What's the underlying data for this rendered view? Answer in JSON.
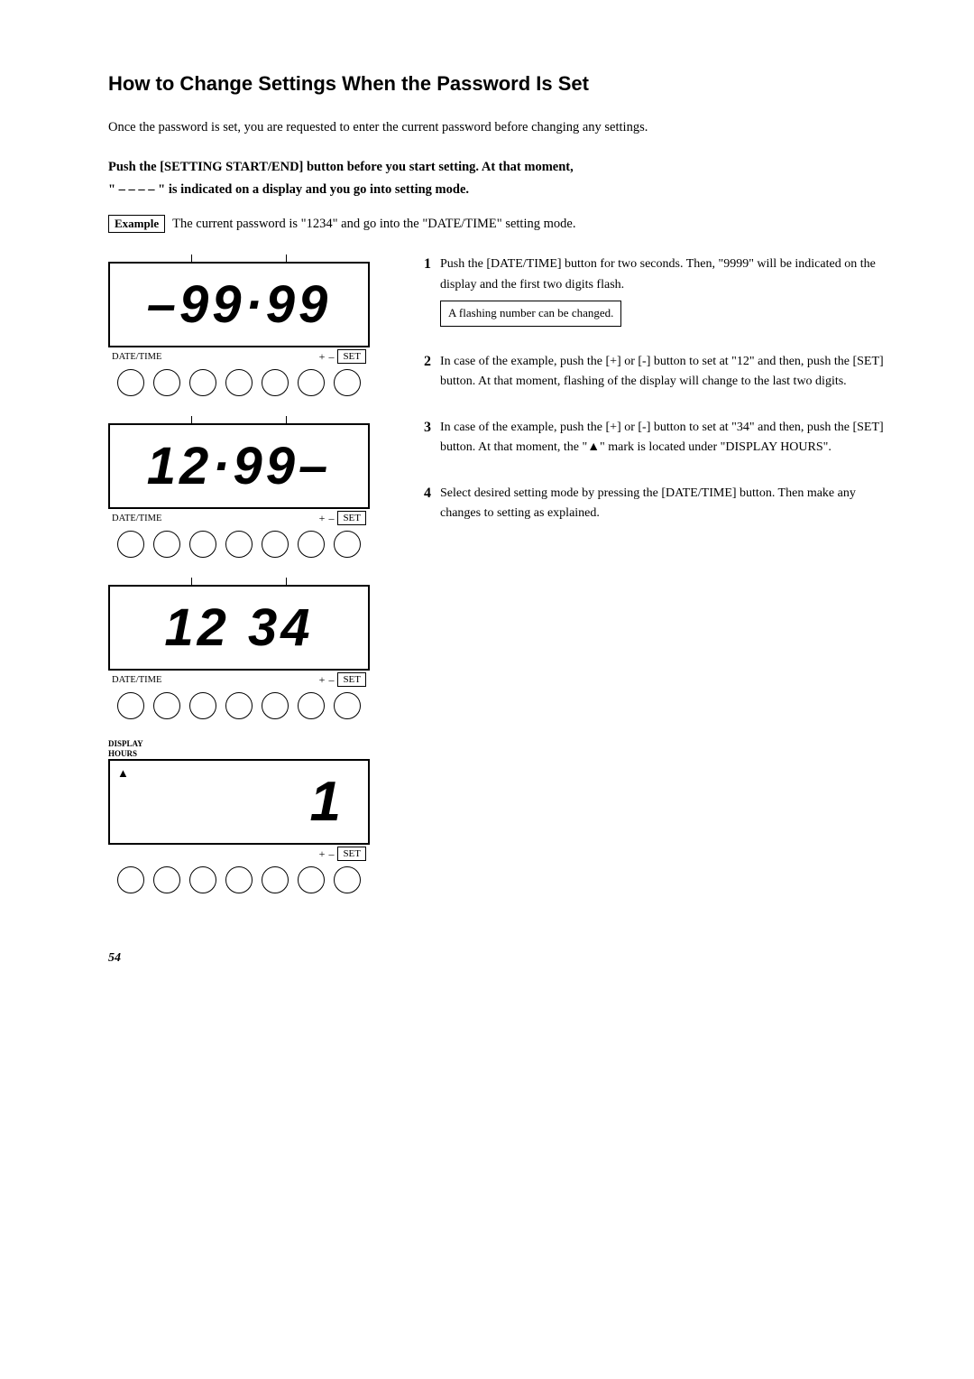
{
  "page": {
    "title": "How to Change Settings When the Password Is Set",
    "intro": "Once the password is set, you are requested to enter the current password before changing any settings.",
    "bold_instruction_1": "Push the [SETTING START/END] button before you start setting.  At that moment,",
    "bold_instruction_2": "\" – – – – \" is indicated on a display and you go into setting mode.",
    "example_label": "Example",
    "example_text": "The current password is \"1234\" and go into the \"DATE/TIME\" setting mode.",
    "page_number": "54",
    "displays": [
      {
        "id": "display1",
        "content": "–99·99",
        "label_left": "DATE/TIME",
        "label_plus": "+",
        "label_minus": "–",
        "label_set": "SET",
        "num_circles": 7
      },
      {
        "id": "display2",
        "content": "12·99–",
        "label_left": "DATE/TIME",
        "label_plus": "+",
        "label_minus": "–",
        "label_set": "SET",
        "num_circles": 7
      },
      {
        "id": "display3",
        "content": "12 34",
        "label_left": "DATE/TIME",
        "label_plus": "+",
        "label_minus": "–",
        "label_set": "SET",
        "num_circles": 7
      },
      {
        "id": "display4",
        "content": "1",
        "display_hours_line1": "DISPLAY",
        "display_hours_line2": "HOURS",
        "arrow": "▲",
        "label_plus": "+",
        "label_minus": "–",
        "label_set": "SET",
        "num_circles": 7
      }
    ],
    "steps": [
      {
        "num": "1",
        "text": "Push the [DATE/TIME] button for two seconds.  Then, \"9999\" will be indicated on the display and the first two digits flash.",
        "flash_note": "A flashing number can be changed."
      },
      {
        "num": "2",
        "text": "In case of the example, push the [+] or [-] button to set at \"12\" and then, push the [SET] button. At that moment, flashing of the display will change to the last two digits.",
        "flash_note": ""
      },
      {
        "num": "3",
        "text": "In case of the example, push the [+] or [-] button to set at \"34\" and then, push the [SET] button. At that moment, the \"▲\" mark is located under \"DISPLAY HOURS\".",
        "flash_note": ""
      },
      {
        "num": "4",
        "text": "Select desired setting mode by pressing the [DATE/TIME] button. Then make any changes to setting as explained.",
        "flash_note": ""
      }
    ]
  }
}
